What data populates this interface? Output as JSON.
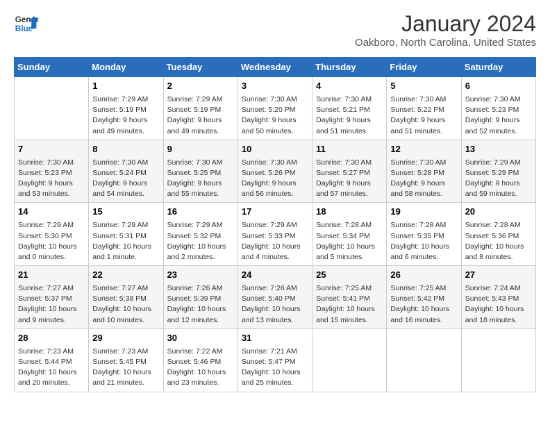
{
  "logo": {
    "line1": "General",
    "line2": "Blue"
  },
  "title": "January 2024",
  "location": "Oakboro, North Carolina, United States",
  "header": {
    "days": [
      "Sunday",
      "Monday",
      "Tuesday",
      "Wednesday",
      "Thursday",
      "Friday",
      "Saturday"
    ]
  },
  "weeks": [
    [
      {
        "day": "",
        "content": ""
      },
      {
        "day": "1",
        "content": "Sunrise: 7:29 AM\nSunset: 5:19 PM\nDaylight: 9 hours\nand 49 minutes."
      },
      {
        "day": "2",
        "content": "Sunrise: 7:29 AM\nSunset: 5:19 PM\nDaylight: 9 hours\nand 49 minutes."
      },
      {
        "day": "3",
        "content": "Sunrise: 7:30 AM\nSunset: 5:20 PM\nDaylight: 9 hours\nand 50 minutes."
      },
      {
        "day": "4",
        "content": "Sunrise: 7:30 AM\nSunset: 5:21 PM\nDaylight: 9 hours\nand 51 minutes."
      },
      {
        "day": "5",
        "content": "Sunrise: 7:30 AM\nSunset: 5:22 PM\nDaylight: 9 hours\nand 51 minutes."
      },
      {
        "day": "6",
        "content": "Sunrise: 7:30 AM\nSunset: 5:23 PM\nDaylight: 9 hours\nand 52 minutes."
      }
    ],
    [
      {
        "day": "7",
        "content": "Sunrise: 7:30 AM\nSunset: 5:23 PM\nDaylight: 9 hours\nand 53 minutes."
      },
      {
        "day": "8",
        "content": "Sunrise: 7:30 AM\nSunset: 5:24 PM\nDaylight: 9 hours\nand 54 minutes."
      },
      {
        "day": "9",
        "content": "Sunrise: 7:30 AM\nSunset: 5:25 PM\nDaylight: 9 hours\nand 55 minutes."
      },
      {
        "day": "10",
        "content": "Sunrise: 7:30 AM\nSunset: 5:26 PM\nDaylight: 9 hours\nand 56 minutes."
      },
      {
        "day": "11",
        "content": "Sunrise: 7:30 AM\nSunset: 5:27 PM\nDaylight: 9 hours\nand 57 minutes."
      },
      {
        "day": "12",
        "content": "Sunrise: 7:30 AM\nSunset: 5:28 PM\nDaylight: 9 hours\nand 58 minutes."
      },
      {
        "day": "13",
        "content": "Sunrise: 7:29 AM\nSunset: 5:29 PM\nDaylight: 9 hours\nand 59 minutes."
      }
    ],
    [
      {
        "day": "14",
        "content": "Sunrise: 7:29 AM\nSunset: 5:30 PM\nDaylight: 10 hours\nand 0 minutes."
      },
      {
        "day": "15",
        "content": "Sunrise: 7:29 AM\nSunset: 5:31 PM\nDaylight: 10 hours\nand 1 minute."
      },
      {
        "day": "16",
        "content": "Sunrise: 7:29 AM\nSunset: 5:32 PM\nDaylight: 10 hours\nand 2 minutes."
      },
      {
        "day": "17",
        "content": "Sunrise: 7:29 AM\nSunset: 5:33 PM\nDaylight: 10 hours\nand 4 minutes."
      },
      {
        "day": "18",
        "content": "Sunrise: 7:28 AM\nSunset: 5:34 PM\nDaylight: 10 hours\nand 5 minutes."
      },
      {
        "day": "19",
        "content": "Sunrise: 7:28 AM\nSunset: 5:35 PM\nDaylight: 10 hours\nand 6 minutes."
      },
      {
        "day": "20",
        "content": "Sunrise: 7:28 AM\nSunset: 5:36 PM\nDaylight: 10 hours\nand 8 minutes."
      }
    ],
    [
      {
        "day": "21",
        "content": "Sunrise: 7:27 AM\nSunset: 5:37 PM\nDaylight: 10 hours\nand 9 minutes."
      },
      {
        "day": "22",
        "content": "Sunrise: 7:27 AM\nSunset: 5:38 PM\nDaylight: 10 hours\nand 10 minutes."
      },
      {
        "day": "23",
        "content": "Sunrise: 7:26 AM\nSunset: 5:39 PM\nDaylight: 10 hours\nand 12 minutes."
      },
      {
        "day": "24",
        "content": "Sunrise: 7:26 AM\nSunset: 5:40 PM\nDaylight: 10 hours\nand 13 minutes."
      },
      {
        "day": "25",
        "content": "Sunrise: 7:25 AM\nSunset: 5:41 PM\nDaylight: 10 hours\nand 15 minutes."
      },
      {
        "day": "26",
        "content": "Sunrise: 7:25 AM\nSunset: 5:42 PM\nDaylight: 10 hours\nand 16 minutes."
      },
      {
        "day": "27",
        "content": "Sunrise: 7:24 AM\nSunset: 5:43 PM\nDaylight: 10 hours\nand 18 minutes."
      }
    ],
    [
      {
        "day": "28",
        "content": "Sunrise: 7:23 AM\nSunset: 5:44 PM\nDaylight: 10 hours\nand 20 minutes."
      },
      {
        "day": "29",
        "content": "Sunrise: 7:23 AM\nSunset: 5:45 PM\nDaylight: 10 hours\nand 21 minutes."
      },
      {
        "day": "30",
        "content": "Sunrise: 7:22 AM\nSunset: 5:46 PM\nDaylight: 10 hours\nand 23 minutes."
      },
      {
        "day": "31",
        "content": "Sunrise: 7:21 AM\nSunset: 5:47 PM\nDaylight: 10 hours\nand 25 minutes."
      },
      {
        "day": "",
        "content": ""
      },
      {
        "day": "",
        "content": ""
      },
      {
        "day": "",
        "content": ""
      }
    ]
  ]
}
